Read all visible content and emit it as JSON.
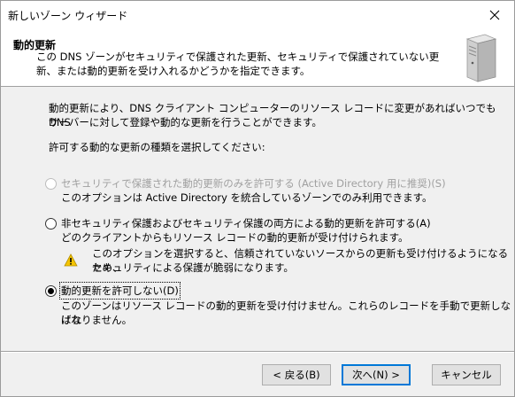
{
  "window": {
    "title": "新しいゾーン ウィザード"
  },
  "header": {
    "title": "動的更新",
    "description": "この DNS ゾーンがセキュリティで保護された更新、セキュリティで保護されていない更新、または動的更新を受け入れるかどうかを指定できます。"
  },
  "intro": {
    "line1": "動的更新により、DNS クライアント コンピューターのリソース レコードに変更があればいつでも DNS",
    "line2": "サーバーに対して登録や動的な更新を行うことができます。"
  },
  "prompt": "許可する動的な更新の種類を選択してください:",
  "options": [
    {
      "label": "セキュリティで保護された動的更新のみを許可する (Active Directory 用に推奨)(S)",
      "desc": "このオプションは Active Directory を統合しているゾーンでのみ利用できます。",
      "checked": false,
      "disabled": true
    },
    {
      "label": "非セキュリティ保護およびセキュリティ保護の両方による動的更新を許可する(A)",
      "desc": "どのクライアントからもリソース レコードの動的更新が受け付けられます。",
      "warning_line1": "このオプションを選択すると、信頼されていないソースからの更新も受け付けるようになるため、",
      "warning_line2": "セキュリティによる保護が脆弱になります。",
      "checked": false,
      "disabled": false
    },
    {
      "label": "動的更新を許可しない(D)",
      "desc_line1": "このゾーンはリソース レコードの動的更新を受け付けません。これらのレコードを手動で更新しなけれ",
      "desc_line2": "ばなりません。",
      "checked": true,
      "disabled": false
    }
  ],
  "buttons": {
    "back": "< 戻る(B)",
    "next": "次へ(N) >",
    "cancel": "キャンセル"
  },
  "icons": {
    "close": "close-icon",
    "server": "server-icon",
    "warning": "warning-icon"
  },
  "colors": {
    "warning": "#f5c400",
    "accent": "#0078d7"
  }
}
